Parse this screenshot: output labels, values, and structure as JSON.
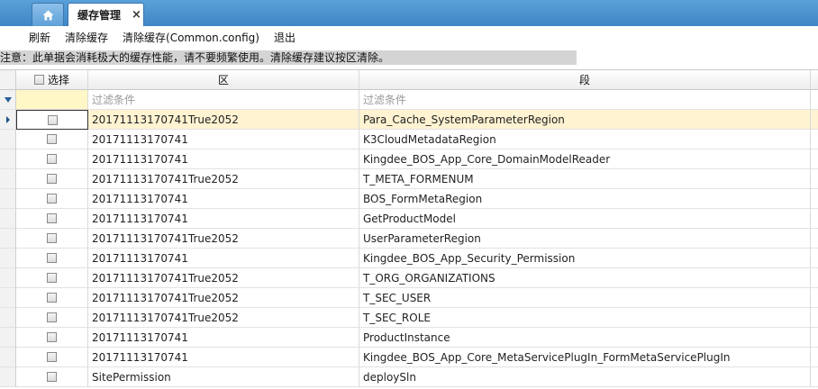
{
  "tabs": {
    "home_icon": "home-icon",
    "active_label": "缓存管理",
    "close_glyph": "×"
  },
  "toolbar": {
    "refresh": "刷新",
    "clear_cache": "清除缓存",
    "clear_common": "清除缓存(Common.config)",
    "exit": "退出"
  },
  "notice": "注意：此单据会消耗极大的缓存性能，请不要频繁使用。清除缓存建议按区清除。",
  "grid": {
    "headers": {
      "select": "选择",
      "region": "区",
      "segment": "段"
    },
    "filter": {
      "region_placeholder": "过滤条件",
      "segment_placeholder": "过滤条件"
    },
    "rows": [
      {
        "region": "20171113170741True2052",
        "segment": "Para_Cache_SystemParameterRegion"
      },
      {
        "region": "20171113170741",
        "segment": "K3CloudMetadataRegion"
      },
      {
        "region": "20171113170741",
        "segment": "Kingdee_BOS_App_Core_DomainModelReader"
      },
      {
        "region": "20171113170741True2052",
        "segment": "T_META_FORMENUM"
      },
      {
        "region": "20171113170741",
        "segment": "BOS_FormMetaRegion"
      },
      {
        "region": "20171113170741",
        "segment": "GetProductModel"
      },
      {
        "region": "20171113170741True2052",
        "segment": "UserParameterRegion"
      },
      {
        "region": "20171113170741",
        "segment": "Kingdee_BOS_App_Security_Permission"
      },
      {
        "region": "20171113170741True2052",
        "segment": "T_ORG_ORGANIZATIONS"
      },
      {
        "region": "20171113170741True2052",
        "segment": "T_SEC_USER"
      },
      {
        "region": "20171113170741True2052",
        "segment": "T_SEC_ROLE"
      },
      {
        "region": "20171113170741",
        "segment": "ProductInstance"
      },
      {
        "region": "20171113170741",
        "segment": "Kingdee_BOS_App_Core_MetaServicePlugIn_FormMetaServicePlugIn"
      },
      {
        "region": "SitePermission",
        "segment": "deploySln"
      }
    ]
  },
  "colors": {
    "tabbar": "#4a90d0",
    "selected_row": "#fff3d2",
    "filter_select_cell": "#fff7c6",
    "notice_bg": "#d4d4d4"
  }
}
